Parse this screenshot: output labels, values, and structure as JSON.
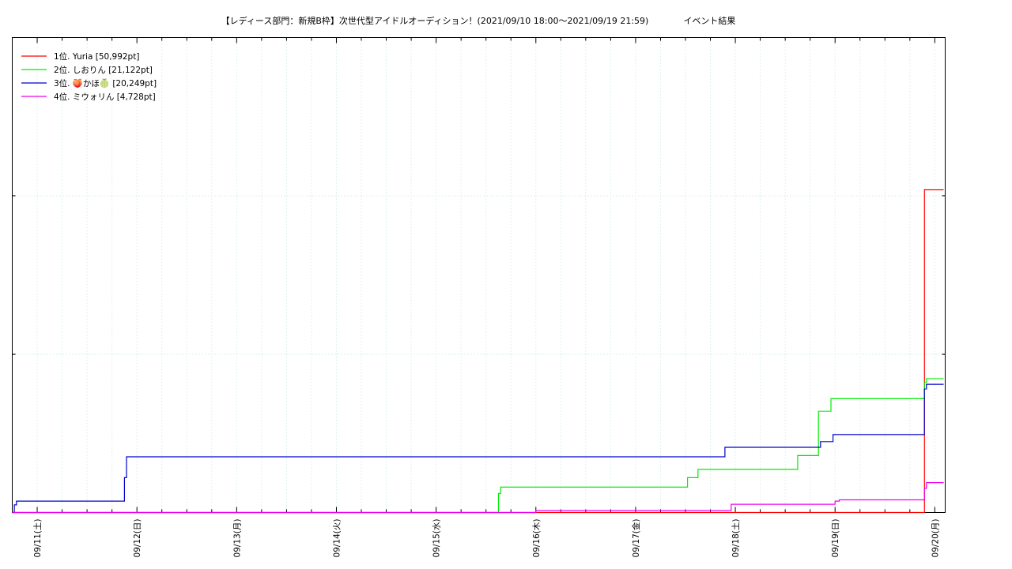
{
  "header": {
    "title": "【レディース部門：新規B枠】次世代型アイドルオーディション！(2021/09/10 18:00〜2021/09/19 21:59)",
    "subtitle": "イベント結果"
  },
  "chart_data": {
    "type": "line",
    "title": "【レディース部門：新規B枠】次世代型アイドルオーディション！(2021/09/10 18:00〜2021/09/19 21:59)　　　イベント結果",
    "xlabel": "",
    "ylabel": "",
    "x_range": [
      "2021-09-10T18:00",
      "2021-09-20T02:30"
    ],
    "ylim": [
      0,
      75000
    ],
    "yticks": [
      0,
      25000,
      50000,
      75000
    ],
    "x_tick_labels": [
      "09/11(土)",
      "09/12(日)",
      "09/13(月)",
      "09/14(火)",
      "09/15(水)",
      "09/16(木)",
      "09/17(金)",
      "09/18(土)",
      "09/19(日)",
      "09/20(月)"
    ],
    "grid": true,
    "legend_position": "top-left",
    "series": [
      {
        "name": "1位. Yuria [50,992pt]",
        "color": "#ff0000",
        "points": [
          [
            "2021-09-10T18:00",
            0
          ],
          [
            "2021-09-19T21:30",
            0
          ],
          [
            "2021-09-19T21:31",
            50992
          ],
          [
            "2021-09-19T21:59",
            50992
          ]
        ]
      },
      {
        "name": "2位. しおりん [21,122pt]",
        "color": "#00ee00",
        "points": [
          [
            "2021-09-10T18:00",
            0
          ],
          [
            "2021-09-15T14:30",
            0
          ],
          [
            "2021-09-15T15:00",
            3000
          ],
          [
            "2021-09-15T15:30",
            4000
          ],
          [
            "2021-09-17T12:00",
            4000
          ],
          [
            "2021-09-17T12:30",
            5500
          ],
          [
            "2021-09-17T14:30",
            5500
          ],
          [
            "2021-09-17T15:00",
            6800
          ],
          [
            "2021-09-18T14:30",
            6800
          ],
          [
            "2021-09-18T15:00",
            9000
          ],
          [
            "2021-09-18T15:30",
            9000
          ],
          [
            "2021-09-18T19:30",
            9000
          ],
          [
            "2021-09-18T20:00",
            16000
          ],
          [
            "2021-09-18T22:30",
            16000
          ],
          [
            "2021-09-18T23:00",
            18000
          ],
          [
            "2021-09-19T21:00",
            18000
          ],
          [
            "2021-09-19T21:30",
            20500
          ],
          [
            "2021-09-19T21:59",
            21122
          ]
        ]
      },
      {
        "name": "3位. 🍑かほ🍈 [20,249pt]",
        "color": "#0000cc",
        "points": [
          [
            "2021-09-10T18:00",
            0
          ],
          [
            "2021-09-10T18:30",
            1200
          ],
          [
            "2021-09-10T19:00",
            1800
          ],
          [
            "2021-09-11T20:30",
            1800
          ],
          [
            "2021-09-11T21:00",
            5500
          ],
          [
            "2021-09-11T21:30",
            8800
          ],
          [
            "2021-09-17T21:00",
            8800
          ],
          [
            "2021-09-17T21:30",
            10300
          ],
          [
            "2021-09-18T20:00",
            10300
          ],
          [
            "2021-09-18T20:30",
            11200
          ],
          [
            "2021-09-18T23:00",
            11200
          ],
          [
            "2021-09-18T23:30",
            12300
          ],
          [
            "2021-09-19T21:00",
            12300
          ],
          [
            "2021-09-19T21:30",
            19500
          ],
          [
            "2021-09-19T21:59",
            20249
          ]
        ]
      },
      {
        "name": "4位. ミウォリん [4,728pt]",
        "color": "#ee00ee",
        "points": [
          [
            "2021-09-10T18:00",
            0
          ],
          [
            "2021-09-15T23:30",
            0
          ],
          [
            "2021-09-16T00:00",
            300
          ],
          [
            "2021-09-17T22:30",
            300
          ],
          [
            "2021-09-17T23:00",
            1300
          ],
          [
            "2021-09-18T23:30",
            1300
          ],
          [
            "2021-09-19T00:00",
            1800
          ],
          [
            "2021-09-19T01:00",
            2000
          ],
          [
            "2021-09-19T21:00",
            2000
          ],
          [
            "2021-09-19T21:30",
            3800
          ],
          [
            "2021-09-19T21:59",
            4728
          ]
        ]
      }
    ]
  }
}
